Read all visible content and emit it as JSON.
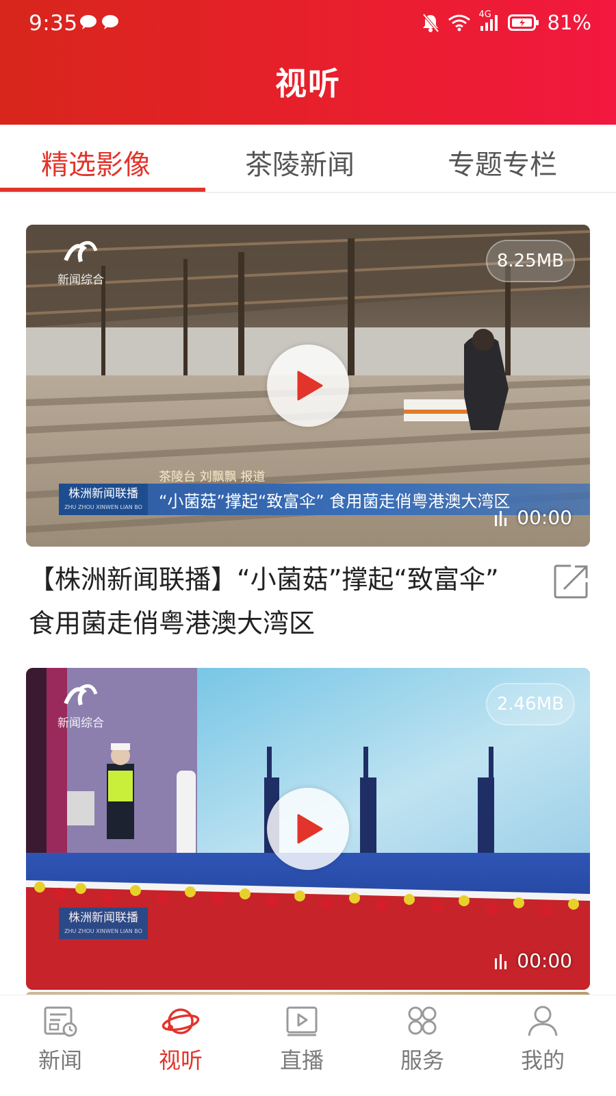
{
  "status_bar": {
    "time": "9:35",
    "network": "4G",
    "battery": "81%"
  },
  "header": {
    "title": "视听"
  },
  "tabs": [
    {
      "label": "精选影像",
      "active": true
    },
    {
      "label": "茶陵新闻",
      "active": false
    },
    {
      "label": "专题专栏",
      "active": false
    }
  ],
  "videos": [
    {
      "size": "8.25MB",
      "duration": "00:00",
      "title": "【株洲新闻联播】“小菌菇”撑起“致富伞” 食用菌走俏粤港澳大湾区",
      "channel": "新闻综合",
      "lower_third": {
        "brand": "株洲新闻联播",
        "brand_sub": "ZHU ZHOU XINWEN LIAN BO",
        "credit": "茶陵台 刘飘飘 报道",
        "headline": "“小菌菇”撑起“致富伞” 食用菌走俏粤港澳大湾区"
      }
    },
    {
      "size": "2.46MB",
      "duration": "00:00",
      "channel": "新闻综合",
      "brand": "株洲新闻联播",
      "brand_sub": "ZHU ZHOU XINWEN LIAN BO"
    }
  ],
  "bottom_nav": [
    {
      "label": "新闻",
      "icon": "news-icon",
      "active": false
    },
    {
      "label": "视听",
      "icon": "planet-icon",
      "active": true
    },
    {
      "label": "直播",
      "icon": "live-play-icon",
      "active": false
    },
    {
      "label": "服务",
      "icon": "services-grid-icon",
      "active": false
    },
    {
      "label": "我的",
      "icon": "profile-icon",
      "active": false
    }
  ],
  "colors": {
    "accent": "#e2342b",
    "header_start": "#d8261c",
    "header_end": "#f2183f",
    "nav_inactive": "#8a8a8a"
  }
}
